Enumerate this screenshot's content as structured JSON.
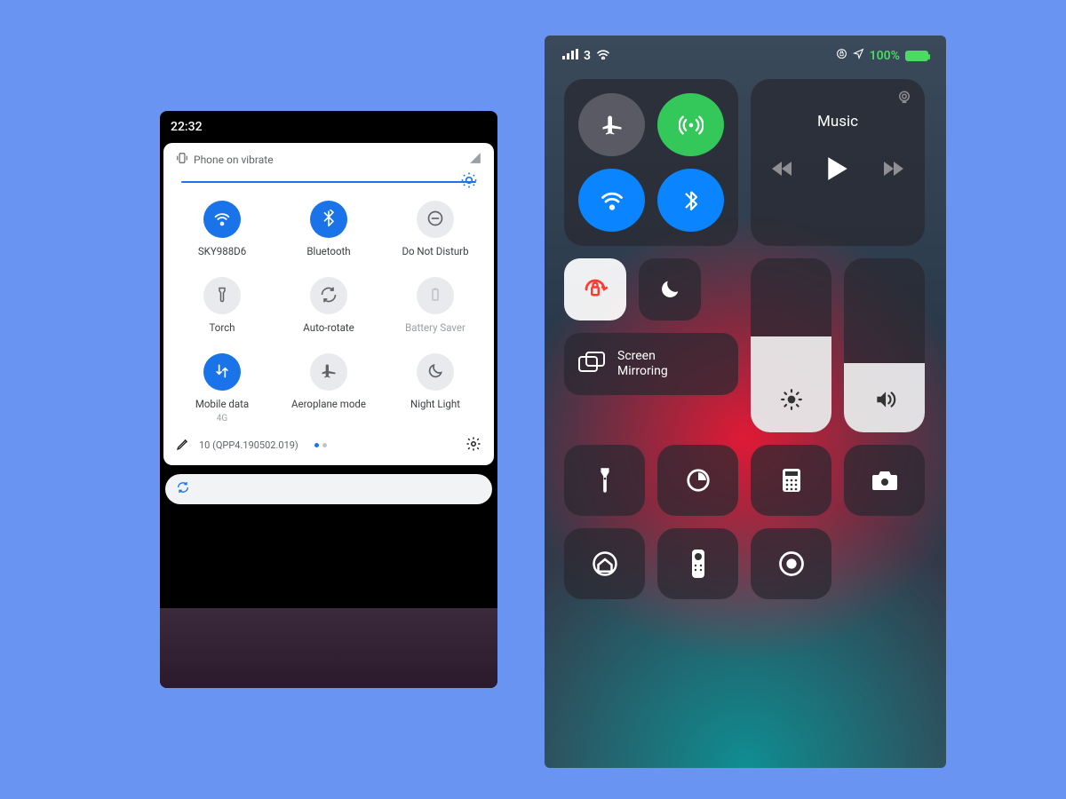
{
  "android": {
    "time": "22:32",
    "top_status": "Phone on vibrate",
    "brightness_percent": 100,
    "tiles": [
      {
        "label": "SKY988D6",
        "icon": "wifi-icon",
        "active": true
      },
      {
        "label": "Bluetooth",
        "icon": "bluetooth-icon",
        "active": true
      },
      {
        "label": "Do Not Disturb",
        "icon": "dnd-icon",
        "active": false
      },
      {
        "label": "Torch",
        "icon": "torch-icon",
        "active": false
      },
      {
        "label": "Auto-rotate",
        "icon": "rotate-icon",
        "active": false
      },
      {
        "label": "Battery Saver",
        "icon": "battery-icon",
        "active": false,
        "dim": true
      },
      {
        "label": "Mobile data",
        "sublabel": "4G",
        "icon": "data-icon",
        "active": true
      },
      {
        "label": "Aeroplane mode",
        "icon": "airplane-icon",
        "active": false
      },
      {
        "label": "Night Light",
        "icon": "moon-icon",
        "active": false
      }
    ],
    "build_label": "10 (QPP4.190502.019)"
  },
  "ios": {
    "carrier": "3",
    "battery_percent": "100%",
    "media_label": "Music",
    "screen_mirror_label": "Screen\nMirroring",
    "brightness_percent": 55,
    "volume_percent": 40
  }
}
